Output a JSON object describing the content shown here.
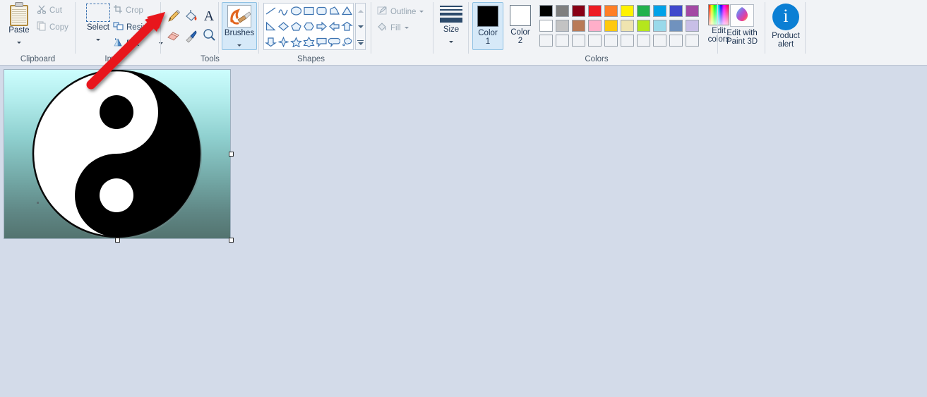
{
  "app": {
    "name": "Paint"
  },
  "ribbon": {
    "groups": [
      {
        "id": "clipboard",
        "label": "Clipboard"
      },
      {
        "id": "image",
        "label": "Ima"
      },
      {
        "id": "tools",
        "label": "Tools"
      },
      {
        "id": "shapes",
        "label": "Shapes"
      },
      {
        "id": "colors",
        "label": "Colors"
      }
    ],
    "clipboard": {
      "paste_label": "Paste",
      "cut_label": "Cut",
      "copy_label": "Copy",
      "paste_icon": "clipboard-icon",
      "cut_icon": "scissors-icon",
      "copy_icon": "copy-pages-icon"
    },
    "image": {
      "select_label": "Select",
      "crop_label": "Crop",
      "resize_label": "Resize",
      "rotate_label": "Rot",
      "select_icon": "dashed-rectangle-icon",
      "crop_icon": "crop-icon",
      "resize_icon": "resize-icon",
      "rotate_icon": "rotate-icon"
    },
    "tools": {
      "items": [
        {
          "name": "pencil-tool",
          "title": "Pencil"
        },
        {
          "name": "fill-with-color-tool",
          "title": "Fill with color"
        },
        {
          "name": "text-tool",
          "title": "Text",
          "glyph": "A"
        },
        {
          "name": "eraser-tool",
          "title": "Eraser"
        },
        {
          "name": "color-picker-tool",
          "title": "Color picker"
        },
        {
          "name": "magnifier-tool",
          "title": "Magnifier"
        }
      ]
    },
    "brushes": {
      "label": "Brushes",
      "selected": true,
      "icon": "paintbrush-icon"
    },
    "shapes": {
      "row1": [
        "line",
        "curve",
        "oval",
        "rectangle",
        "rounded-rectangle",
        "polygon",
        "triangle"
      ],
      "row2": [
        "right-triangle",
        "diamond",
        "pentagon",
        "hexagon",
        "right-arrow",
        "left-arrow",
        "up-arrow"
      ],
      "row3": [
        "down-arrow",
        "four-point-star",
        "five-point-star",
        "six-point-star",
        "rectangular-callout",
        "rounded-callout",
        "cloud-callout"
      ],
      "scroll_up": "scroll-up-arrow",
      "scroll_down": "scroll-down-arrow",
      "more": "more-shapes-arrow"
    },
    "outline": {
      "outline_label": "Outline",
      "fill_label": "Fill",
      "outline_enabled": false,
      "fill_enabled": false
    },
    "size": {
      "label": "Size",
      "strokes": [
        1,
        2,
        4,
        7
      ]
    },
    "colors": {
      "color1_label_line1": "Color",
      "color1_label_line2": "1",
      "color2_label_line1": "Color",
      "color2_label_line2": "2",
      "color1_value": "#000000",
      "color2_value": "#ffffff",
      "color1_selected": true,
      "edit_colors_line1": "Edit",
      "edit_colors_line2": "colors",
      "palette_row1": [
        "#000000",
        "#7f7f7f",
        "#880015",
        "#ed1c24",
        "#ff7f27",
        "#fff200",
        "#22b14c",
        "#00a2e8",
        "#3f48cc",
        "#a349a4"
      ],
      "palette_row2": [
        "#ffffff",
        "#c3c3c3",
        "#b97a57",
        "#ffaec9",
        "#ffc90e",
        "#efe4b0",
        "#b5e61d",
        "#99d9ea",
        "#7092be",
        "#c8bfe7"
      ],
      "palette_row3": [
        "",
        "",
        "",
        "",
        "",
        "",
        "",
        "",
        "",
        ""
      ]
    },
    "paint3d": {
      "label_line1": "Edit with",
      "label_line2": "Paint 3D",
      "icon": "paint3d-icon"
    },
    "alert": {
      "label_line1": "Product",
      "label_line2": "alert",
      "glyph": "i",
      "icon": "info-circle-icon",
      "accent": "#0b7fd4"
    }
  },
  "canvas": {
    "image_name": "yin-yang-symbol",
    "background_top": "#ccfdfd",
    "background_bottom": "#53736f",
    "selection_active": true,
    "handles": [
      "right-middle",
      "bottom-right",
      "bottom-middle"
    ]
  },
  "annotation": {
    "arrow_name": "red-annotation-arrow",
    "color": "#e8151c",
    "points_to": "pencil-tool"
  },
  "workspace": {
    "background": "#d3dbe9"
  }
}
